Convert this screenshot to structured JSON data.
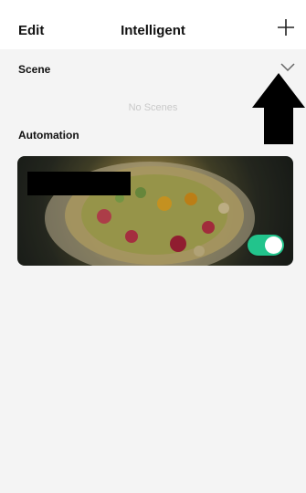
{
  "header": {
    "edit_label": "Edit",
    "title": "Intelligent",
    "add_icon": "plus-icon"
  },
  "scene": {
    "label": "Scene",
    "expand_icon": "chevron-down-icon",
    "empty_text": "No Scenes"
  },
  "automation": {
    "label": "Automation",
    "items": [
      {
        "toggle_on": true,
        "toggle_color": "#22c48c"
      }
    ]
  },
  "colors": {
    "background": "#f4f4f4",
    "header_bg": "#ffffff",
    "accent": "#22c48c"
  },
  "annotation_icon": "arrow-up-icon"
}
